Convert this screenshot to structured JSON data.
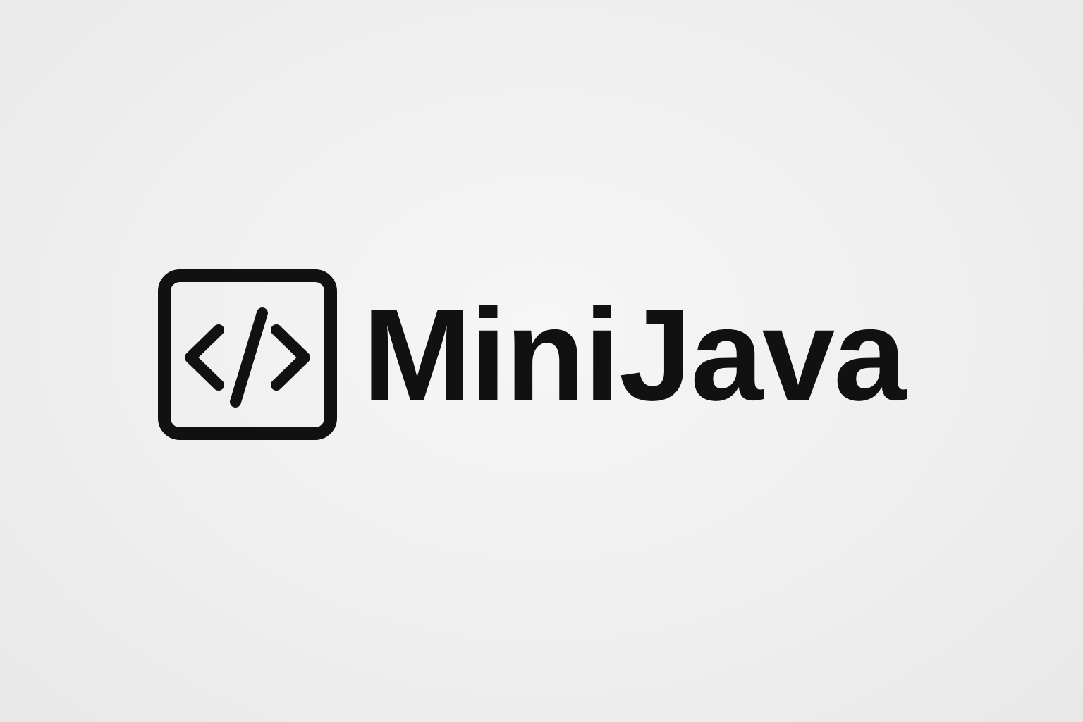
{
  "brand": {
    "name": "MiniJava",
    "icon": "code-brackets-icon",
    "text_color": "#111111",
    "icon_color": "#111111",
    "background_color": "#efefef"
  }
}
